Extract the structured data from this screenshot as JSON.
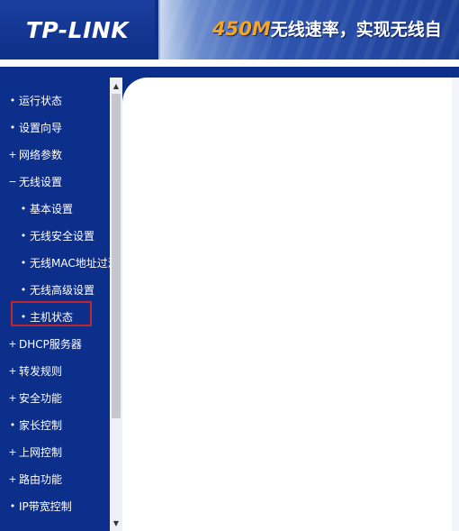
{
  "header": {
    "logo": "TP-LINK",
    "banner_number": "450M",
    "banner_text": "无线速率，实现无线自"
  },
  "sidebar": {
    "items": [
      {
        "mark": "•",
        "label": "运行状态",
        "level": 0
      },
      {
        "mark": "•",
        "label": "设置向导",
        "level": 0
      },
      {
        "mark": "+",
        "label": "网络参数",
        "level": 0
      },
      {
        "mark": "−",
        "label": "无线设置",
        "level": 0
      },
      {
        "mark": "•",
        "label": "基本设置",
        "level": 1
      },
      {
        "mark": "•",
        "label": "无线安全设置",
        "level": 1
      },
      {
        "mark": "•",
        "label": "无线MAC地址过滤",
        "level": 1
      },
      {
        "mark": "•",
        "label": "无线高级设置",
        "level": 1
      },
      {
        "mark": "•",
        "label": "主机状态",
        "level": 1,
        "selected": true
      },
      {
        "mark": "+",
        "label": "DHCP服务器",
        "level": 0
      },
      {
        "mark": "+",
        "label": "转发规则",
        "level": 0
      },
      {
        "mark": "+",
        "label": "安全功能",
        "level": 0
      },
      {
        "mark": "•",
        "label": "家长控制",
        "level": 0
      },
      {
        "mark": "+",
        "label": "上网控制",
        "level": 0
      },
      {
        "mark": "+",
        "label": "路由功能",
        "level": 0
      },
      {
        "mark": "•",
        "label": "IP带宽控制",
        "level": 0
      }
    ]
  },
  "scrollbar": {
    "up_icon": "triangle-up",
    "down_icon": "triangle-down"
  },
  "colors": {
    "brand_blue": "#0d2f8c",
    "highlight_border": "#c0262e",
    "banner_accent": "#f6a623"
  }
}
